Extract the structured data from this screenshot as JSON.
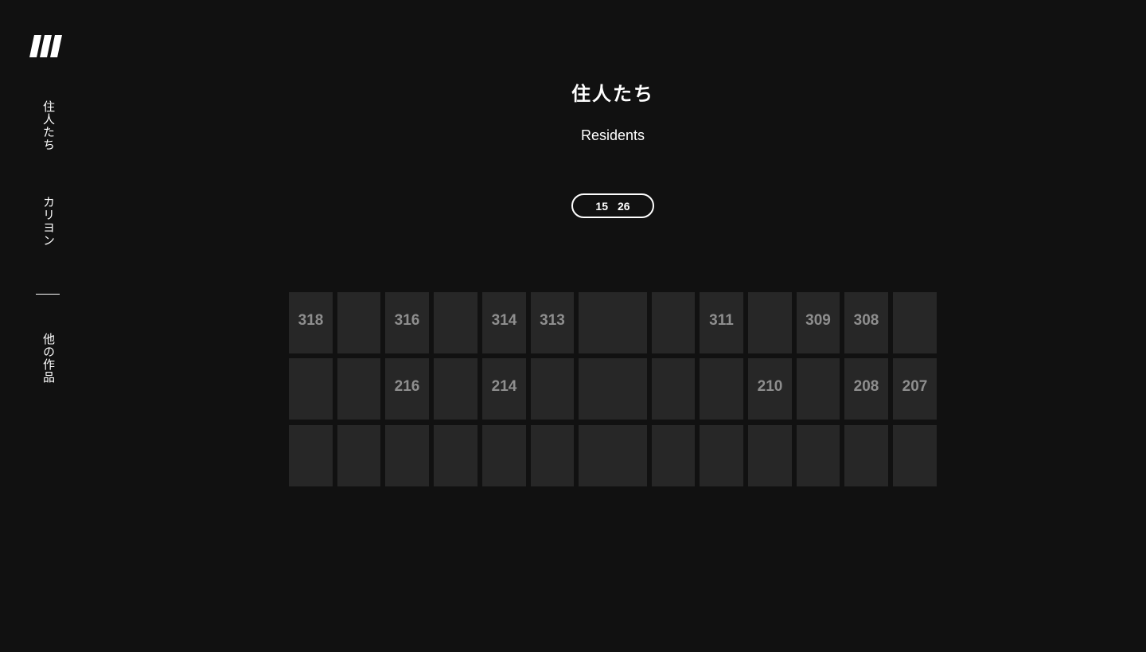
{
  "sidebar": {
    "logo_icon": "stripes-logo-icon",
    "items": [
      {
        "label": "住人たち"
      },
      {
        "label": "カリヨン"
      },
      {
        "label": "他の作品"
      }
    ]
  },
  "main": {
    "title_ja": "住人たち",
    "title_en": "Residents",
    "filter": {
      "start": "15",
      "end": "26"
    }
  },
  "rooms": {
    "rows": [
      [
        "318",
        "",
        "316",
        "",
        "314",
        "313",
        "",
        "",
        "311",
        "",
        "309",
        "308",
        ""
      ],
      [
        "",
        "",
        "216",
        "",
        "214",
        "",
        "",
        "",
        "",
        "210",
        "",
        "208",
        "207"
      ],
      [
        "",
        "",
        "",
        "",
        "",
        "",
        "",
        "",
        "",
        "",
        "",
        "",
        ""
      ]
    ]
  },
  "colors": {
    "background": "#111111",
    "cell": "#272727",
    "cell_text": "#8e8e8e",
    "text": "#ffffff"
  }
}
